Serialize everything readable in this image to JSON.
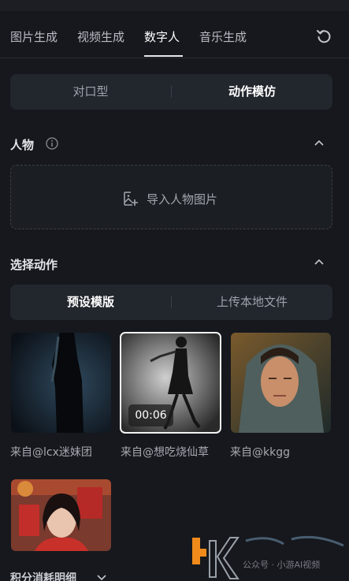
{
  "tabs": [
    "图片生成",
    "视频生成",
    "数字人",
    "音乐生成"
  ],
  "mode_switch": {
    "left": "对口型",
    "right": "动作模仿"
  },
  "person_section": {
    "title": "人物",
    "upload_label": "导入人物图片"
  },
  "motion_section": {
    "title": "选择动作",
    "left": "预设模版",
    "right": "上传本地文件"
  },
  "templates": [
    {
      "caption": "来自@lcx迷妹团"
    },
    {
      "caption": "来自@想吃烧仙草",
      "duration": "00:06"
    },
    {
      "caption": "来自@kkgg"
    },
    {
      "caption": ""
    }
  ],
  "bottom_label": "积分消耗明细",
  "watermark_text": "公众号 · 小游AI视频"
}
